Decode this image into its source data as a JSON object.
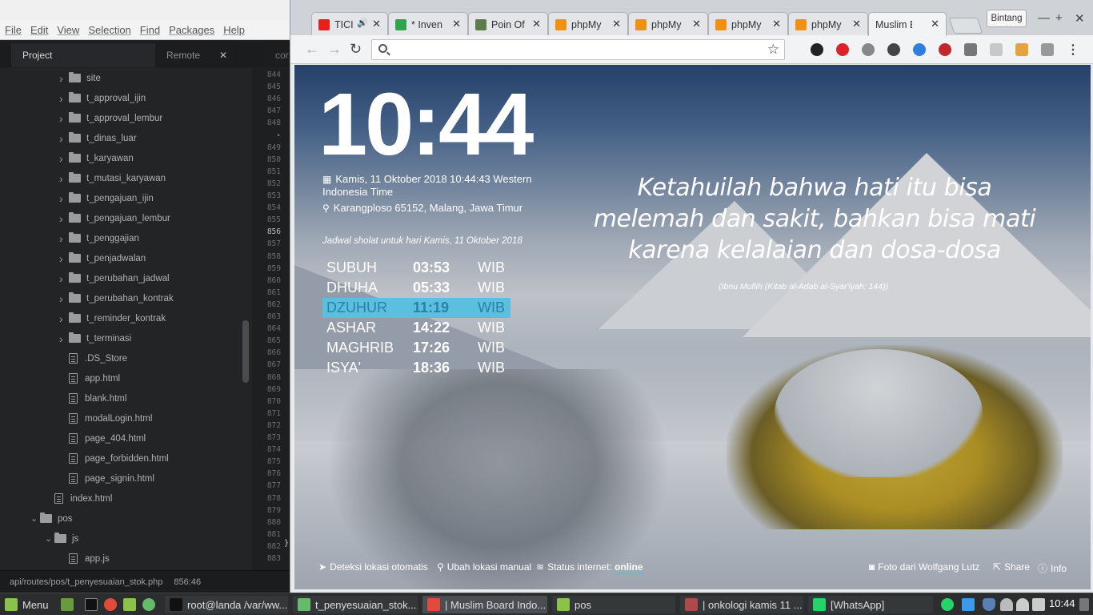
{
  "editor": {
    "menu": [
      "File",
      "Edit",
      "View",
      "Selection",
      "Find",
      "Packages",
      "Help"
    ],
    "tabs": {
      "project": "Project",
      "remote": "Remote",
      "close": "✕",
      "code_tab": "cor"
    },
    "tree": [
      {
        "label": "site",
        "kind": "folder",
        "level": 2,
        "collapsed": true
      },
      {
        "label": "t_approval_ijin",
        "kind": "folder",
        "level": 2,
        "collapsed": true
      },
      {
        "label": "t_approval_lembur",
        "kind": "folder",
        "level": 2,
        "collapsed": true
      },
      {
        "label": "t_dinas_luar",
        "kind": "folder",
        "level": 2,
        "collapsed": true
      },
      {
        "label": "t_karyawan",
        "kind": "folder",
        "level": 2,
        "collapsed": true
      },
      {
        "label": "t_mutasi_karyawan",
        "kind": "folder",
        "level": 2,
        "collapsed": true
      },
      {
        "label": "t_pengajuan_ijin",
        "kind": "folder",
        "level": 2,
        "collapsed": true
      },
      {
        "label": "t_pengajuan_lembur",
        "kind": "folder",
        "level": 2,
        "collapsed": true
      },
      {
        "label": "t_penggajian",
        "kind": "folder",
        "level": 2,
        "collapsed": true
      },
      {
        "label": "t_penjadwalan",
        "kind": "folder",
        "level": 2,
        "collapsed": true
      },
      {
        "label": "t_perubahan_jadwal",
        "kind": "folder",
        "level": 2,
        "collapsed": true
      },
      {
        "label": "t_perubahan_kontrak",
        "kind": "folder",
        "level": 2,
        "collapsed": true
      },
      {
        "label": "t_reminder_kontrak",
        "kind": "folder",
        "level": 2,
        "collapsed": true
      },
      {
        "label": "t_terminasi",
        "kind": "folder",
        "level": 2,
        "collapsed": true
      },
      {
        "label": ".DS_Store",
        "kind": "file",
        "level": 2
      },
      {
        "label": "app.html",
        "kind": "file",
        "level": 2
      },
      {
        "label": "blank.html",
        "kind": "file",
        "level": 2
      },
      {
        "label": "modalLogin.html",
        "kind": "file",
        "level": 2
      },
      {
        "label": "page_404.html",
        "kind": "file",
        "level": 2
      },
      {
        "label": "page_forbidden.html",
        "kind": "file",
        "level": 2
      },
      {
        "label": "page_signin.html",
        "kind": "file",
        "level": 2
      },
      {
        "label": "index.html",
        "kind": "file",
        "level": 1
      },
      {
        "label": "pos",
        "kind": "folder",
        "level": 0,
        "collapsed": false
      },
      {
        "label": "js",
        "kind": "folder",
        "level": 1,
        "collapsed": false
      },
      {
        "label": "app.js",
        "kind": "file",
        "level": 2
      }
    ],
    "line_numbers": [
      "844",
      "845",
      "846",
      "847",
      "848",
      "•",
      "849",
      "850",
      "851",
      "852",
      "853",
      "854",
      "855",
      "856",
      "857",
      "858",
      "859",
      "860",
      "861",
      "862",
      "863",
      "864",
      "865",
      "866",
      "867",
      "868",
      "869",
      "870",
      "871",
      "872",
      "873",
      "874",
      "875",
      "876",
      "877",
      "878",
      "879",
      "880",
      "881",
      "882",
      "883"
    ],
    "active_line": "856",
    "code_fragment": "}",
    "status": {
      "path": "api/routes/pos/t_penyesuaian_stok.php",
      "cursor": "856:46"
    }
  },
  "browser": {
    "tabs": [
      {
        "label": "TICI",
        "icon_color": "#e62117",
        "icon": "youtube-icon",
        "audio": "🔊"
      },
      {
        "label": "* Inven",
        "icon_color": "#2ea44f",
        "icon": "inventory-icon"
      },
      {
        "label": "Poin Of",
        "icon_color": "#5a7d4a",
        "icon": "pos-icon"
      },
      {
        "label": "phpMy",
        "icon_color": "#f29111",
        "icon": "phpmyadmin-icon"
      },
      {
        "label": "phpMy",
        "icon_color": "#f29111",
        "icon": "phpmyadmin-icon"
      },
      {
        "label": "phpMy",
        "icon_color": "#f29111",
        "icon": "phpmyadmin-icon"
      },
      {
        "label": "phpMy",
        "icon_color": "#f29111",
        "icon": "phpmyadmin-icon"
      },
      {
        "label": "Muslim Boa",
        "icon": "none",
        "active": true
      }
    ],
    "tab_close": "✕",
    "profile_name": "Bintang",
    "window_buttons": {
      "minimize": "—",
      "maximize": "+",
      "close": "✕"
    },
    "nav": {
      "back": "←",
      "forward": "→",
      "reload": "↻"
    },
    "omnibox": {
      "value": "",
      "placeholder": ""
    },
    "bookmark_star": "☆",
    "extensions": [
      {
        "icon": "camera-extension-icon",
        "color": "#222"
      },
      {
        "icon": "opera-extension-icon",
        "color": "#e0202a"
      },
      {
        "icon": "function-extension-icon",
        "color": "#888"
      },
      {
        "icon": "eyedropper-extension-icon",
        "color": "#444"
      },
      {
        "icon": "google-extension-icon",
        "color": "#2f7fdf"
      },
      {
        "icon": "seo-extension-icon",
        "color": "#c0282d"
      },
      {
        "icon": "wrench-extension-icon",
        "color": "#777"
      },
      {
        "icon": "triangle-extension-icon",
        "color": "#c8c8c8"
      },
      {
        "icon": "tool-extension-icon",
        "color": "#e6a23c"
      },
      {
        "icon": "controller-extension-icon",
        "color": "#999"
      }
    ],
    "menu_icon": "⋮"
  },
  "page": {
    "time": "10:44",
    "date_line1": "Kamis, 11 Oktober 2018 10:44:43 Western",
    "date_line2": "Indonesia Time",
    "location": "Karangploso 65152, Malang, Jawa Timur",
    "schedule_title": "Jadwal sholat untuk hari Kamis, 11 Oktober 2018",
    "prayers": [
      {
        "name": "SUBUH",
        "time": "03:53",
        "zone": "WIB"
      },
      {
        "name": "DHUHA",
        "time": "05:33",
        "zone": "WIB"
      },
      {
        "name": "DZUHUR",
        "time": "11:19",
        "zone": "WIB",
        "highlight": true
      },
      {
        "name": "ASHAR",
        "time": "14:22",
        "zone": "WIB"
      },
      {
        "name": "MAGHRIB",
        "time": "17:26",
        "zone": "WIB"
      },
      {
        "name": "ISYA'",
        "time": "18:36",
        "zone": "WIB"
      }
    ],
    "highlight_color": "#5bc0de",
    "quote": "Ketahuilah bahwa hati itu bisa melemah dan sakit, bahkan bisa mati karena kelalaian dan dosa-dosa",
    "quote_source": "(Ibnu Muflih (Kitab al-Adab al-Syar'iyah: 144))",
    "footer": {
      "auto_location": "Deteksi lokasi otomatis",
      "manual_location": "Ubah lokasi manual",
      "internet_label": "Status internet:",
      "internet_status": "online",
      "photo_credit": "Foto dari Wolfgang Lutz",
      "share": "Share",
      "info": "Info"
    }
  },
  "taskbar": {
    "menu_label": "Menu",
    "tasks": [
      {
        "label": "root@landa /var/ww...",
        "icon": "terminal-icon",
        "color": "#111"
      },
      {
        "label": "t_penyesuaian_stok....",
        "icon": "atom-icon",
        "color": "#66bb6a"
      },
      {
        "label": "| Muslim Board Indo...",
        "icon": "chrome-icon",
        "color": "#e14b3b",
        "active": true
      },
      {
        "label": "pos",
        "icon": "folder-icon",
        "color": "#8bc34a"
      },
      {
        "label": "| onkologi kamis 11 ...",
        "icon": "document-icon",
        "color": "#b04a4a"
      },
      {
        "label": "[WhatsApp]",
        "icon": "whatsapp-icon",
        "color": "#25d366"
      }
    ],
    "clock": "10:44"
  }
}
